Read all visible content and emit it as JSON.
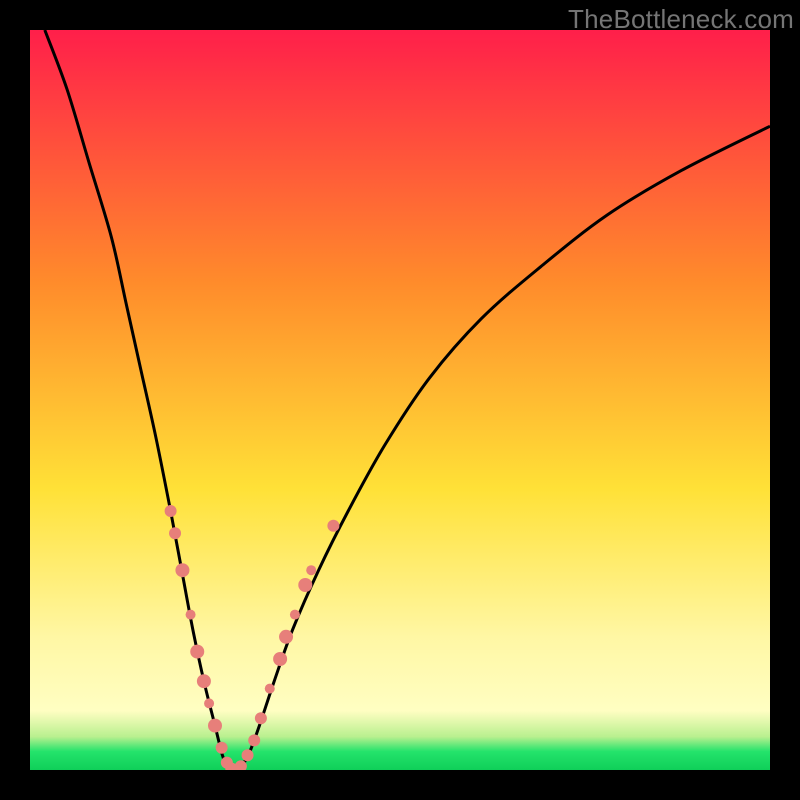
{
  "watermark": "TheBottleneck.com",
  "colors": {
    "top_red": "#ff1f4a",
    "orange": "#ff8b2b",
    "yellow": "#ffe137",
    "pale_yellow": "#fff7a4",
    "green": "#24e36b",
    "curve": "#000000",
    "marker": "#e77f7a",
    "frame": "#000000"
  },
  "chart_data": {
    "type": "line",
    "title": "",
    "xlabel": "",
    "ylabel": "",
    "xlim": [
      0,
      100
    ],
    "ylim": [
      0,
      100
    ],
    "gradient_stops": [
      {
        "pos": 0.0,
        "color": "#ff1f4a"
      },
      {
        "pos": 0.34,
        "color": "#ff8b2b"
      },
      {
        "pos": 0.62,
        "color": "#ffe137"
      },
      {
        "pos": 0.82,
        "color": "#fff7a4"
      },
      {
        "pos": 0.92,
        "color": "#fffec2"
      },
      {
        "pos": 0.955,
        "color": "#b9f08f"
      },
      {
        "pos": 0.975,
        "color": "#24e36b"
      },
      {
        "pos": 1.0,
        "color": "#0fcf59"
      }
    ],
    "series": [
      {
        "name": "left-curve",
        "x": [
          2,
          5,
          8,
          11,
          13,
          15,
          17,
          19,
          20.5,
          22,
          23.5,
          25,
          26,
          26.8
        ],
        "y": [
          100,
          92,
          82,
          72,
          63,
          54,
          45,
          35,
          27,
          19,
          12,
          6,
          2,
          0
        ]
      },
      {
        "name": "right-curve",
        "x": [
          28.2,
          29.5,
          31,
          33,
          35.5,
          39,
          43,
          48,
          54,
          61,
          69,
          78,
          88,
          100
        ],
        "y": [
          0,
          2,
          6,
          12,
          19,
          27,
          35,
          44,
          53,
          61,
          68,
          75,
          81,
          87
        ]
      }
    ],
    "flat_bottom": {
      "x0": 26.8,
      "x1": 28.2,
      "y": 0
    },
    "markers": [
      {
        "series": "left",
        "x": 19.0,
        "y": 35,
        "r": 6
      },
      {
        "series": "left",
        "x": 19.6,
        "y": 32,
        "r": 6
      },
      {
        "series": "left",
        "x": 20.6,
        "y": 27,
        "r": 7
      },
      {
        "series": "left",
        "x": 21.7,
        "y": 21,
        "r": 5
      },
      {
        "series": "left",
        "x": 22.6,
        "y": 16,
        "r": 7
      },
      {
        "series": "left",
        "x": 23.5,
        "y": 12,
        "r": 7
      },
      {
        "series": "left",
        "x": 24.2,
        "y": 9,
        "r": 5
      },
      {
        "series": "left",
        "x": 25.0,
        "y": 6,
        "r": 7
      },
      {
        "series": "left",
        "x": 25.9,
        "y": 3,
        "r": 6
      },
      {
        "series": "left",
        "x": 26.6,
        "y": 1,
        "r": 6
      },
      {
        "series": "left",
        "x": 27.2,
        "y": 0.2,
        "r": 6
      },
      {
        "series": "left",
        "x": 27.9,
        "y": 0.2,
        "r": 5
      },
      {
        "series": "right",
        "x": 28.5,
        "y": 0.5,
        "r": 6
      },
      {
        "series": "right",
        "x": 29.4,
        "y": 2,
        "r": 6
      },
      {
        "series": "right",
        "x": 30.3,
        "y": 4,
        "r": 6
      },
      {
        "series": "right",
        "x": 31.2,
        "y": 7,
        "r": 6
      },
      {
        "series": "right",
        "x": 32.4,
        "y": 11,
        "r": 5
      },
      {
        "series": "right",
        "x": 33.8,
        "y": 15,
        "r": 7
      },
      {
        "series": "right",
        "x": 34.6,
        "y": 18,
        "r": 7
      },
      {
        "series": "right",
        "x": 35.8,
        "y": 21,
        "r": 5
      },
      {
        "series": "right",
        "x": 37.2,
        "y": 25,
        "r": 7
      },
      {
        "series": "right",
        "x": 38.0,
        "y": 27,
        "r": 5
      },
      {
        "series": "right",
        "x": 41.0,
        "y": 33,
        "r": 6
      }
    ]
  }
}
